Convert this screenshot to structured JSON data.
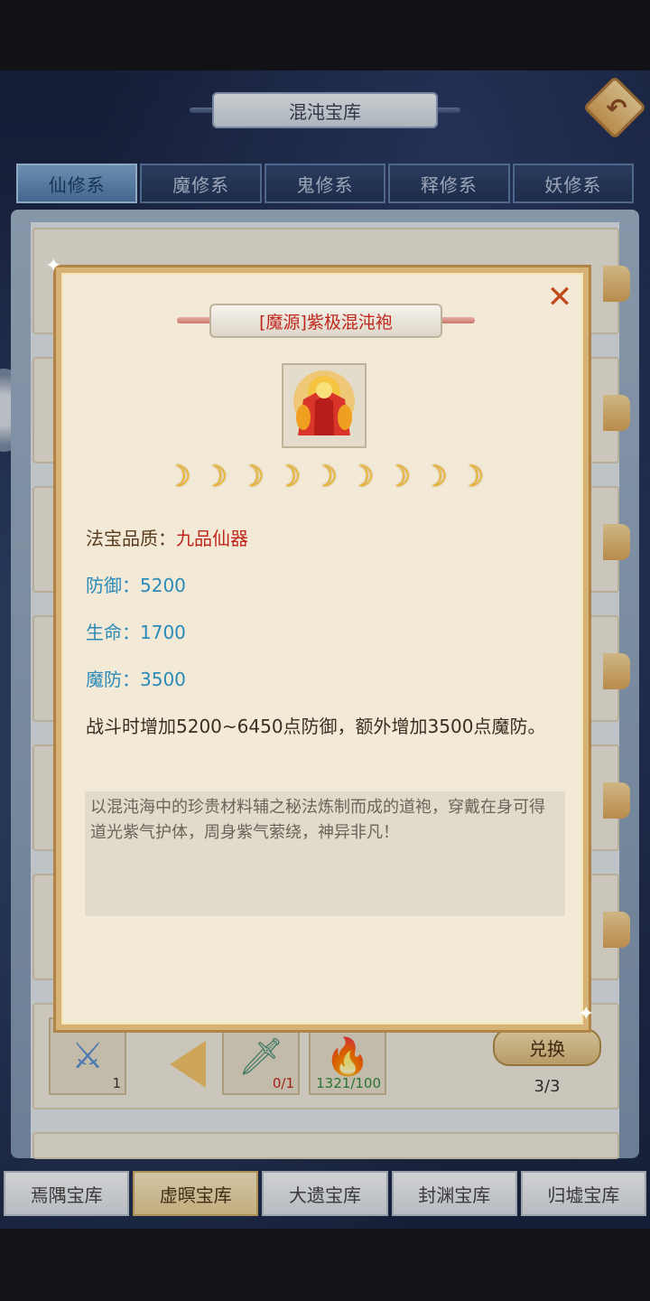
{
  "header": {
    "title": "混沌宝库"
  },
  "category_tabs": [
    {
      "label": "仙修系",
      "active": true
    },
    {
      "label": "魔修系",
      "active": false
    },
    {
      "label": "鬼修系",
      "active": false
    },
    {
      "label": "释修系",
      "active": false
    },
    {
      "label": "妖修系",
      "active": false
    }
  ],
  "exchange_row": {
    "slot1_count": "1",
    "slot2_count": "0/1",
    "slot3_count": "1321/100",
    "button_label": "兑换",
    "exchange_count": "3/3"
  },
  "library_tabs": [
    {
      "label": "焉隅宝库",
      "active": false
    },
    {
      "label": "虚暝宝库",
      "active": true
    },
    {
      "label": "大遗宝库",
      "active": false
    },
    {
      "label": "封渊宝库",
      "active": false
    },
    {
      "label": "归墟宝库",
      "active": false
    }
  ],
  "item": {
    "name": "[魔源]紫极混沌袍",
    "star_count": 9,
    "star_glyph": "☽",
    "quality_label": "法宝品质：",
    "quality_value": "九品仙器",
    "defense": "防御：5200",
    "hp": "生命：1700",
    "magic_defense": "魔防：3500",
    "effect": "战斗时增加5200~6450点防御，额外增加3500点魔防。",
    "description": "以混沌海中的珍贵材料辅之秘法炼制而成的道袍，穿戴在身可得道光紫气护体，周身紫气萦绕，神异非凡！",
    "close_glyph": "✕"
  },
  "icons": {
    "back": "↶"
  },
  "colors": {
    "quality_red": "#c0261c",
    "stat_blue": "#2b8ab8",
    "modal_border": "#d6b276"
  }
}
